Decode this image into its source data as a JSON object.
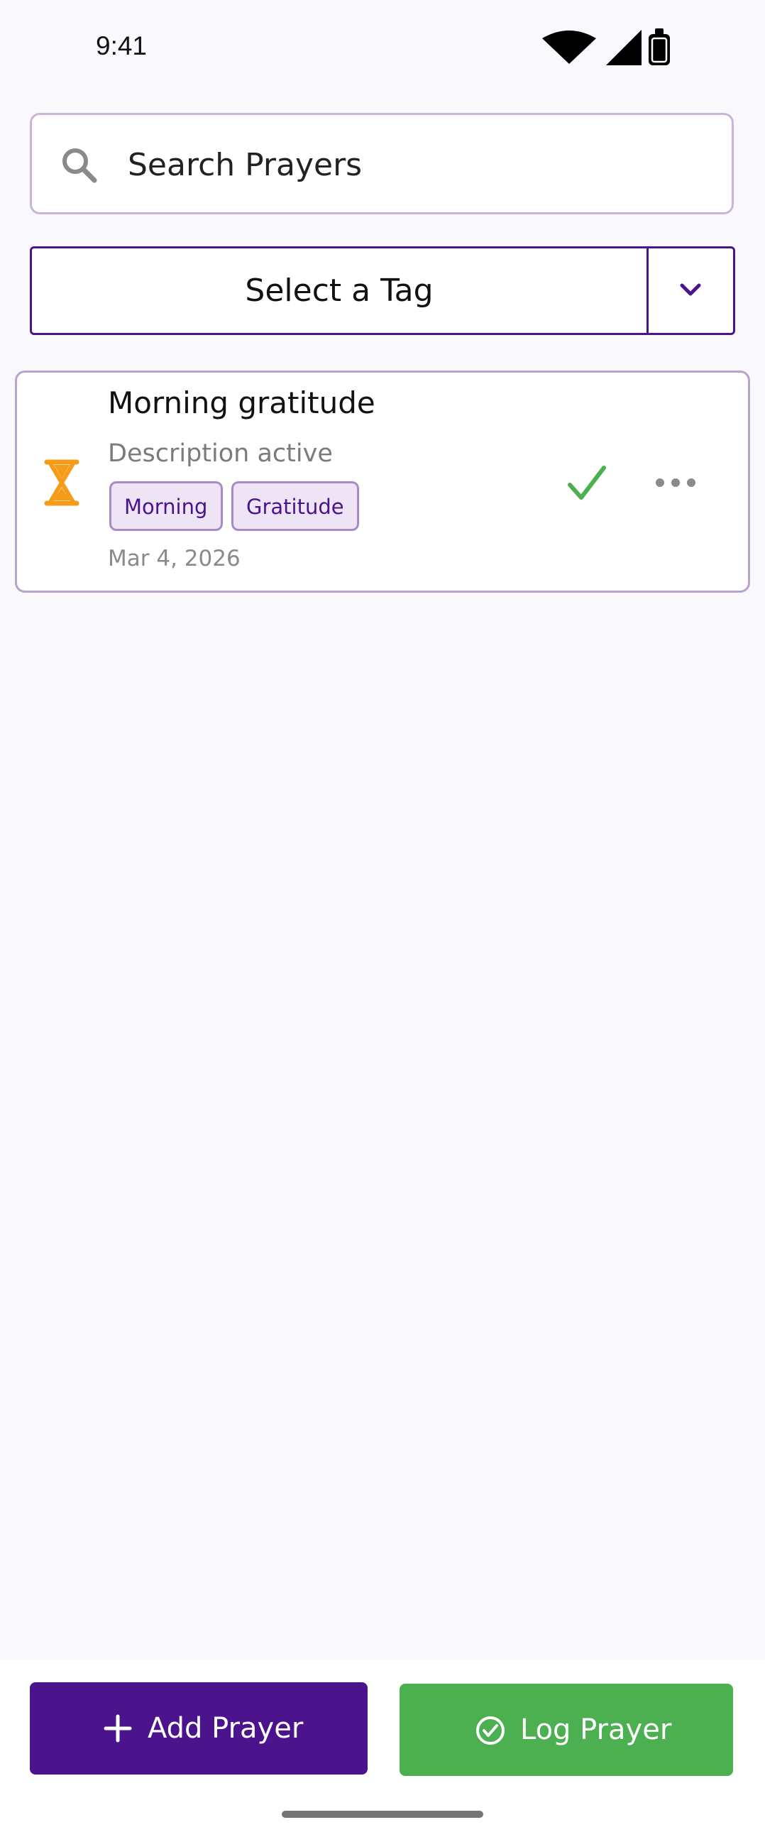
{
  "status_bar": {
    "time": "9:41",
    "icons": [
      "wifi-icon",
      "signal-icon",
      "battery-icon"
    ]
  },
  "search": {
    "placeholder": "Search Prayers",
    "value": "",
    "icon": "search-icon"
  },
  "tag_filter": {
    "label": "Select a Tag",
    "dropdown_icon": "chevron-down-icon"
  },
  "prayers": [
    {
      "title": "Morning gratitude",
      "description": "Description active",
      "tags": [
        "Morning",
        "Gratitude"
      ],
      "date": "Mar 4, 2026",
      "status_icon": "hourglass-icon",
      "answered_icon": "check-icon",
      "menu_icon": "more-horizontal-icon"
    }
  ],
  "actions": {
    "add_prayer": "Add Prayer",
    "log_prayer": "Log Prayer"
  },
  "colors": {
    "primary": "#4b138c",
    "success": "#4caf50",
    "pending": "#f59c1a",
    "background": "#f9f8fc",
    "chip_bg": "#ede4f5",
    "card_border": "#b8a3cc"
  }
}
